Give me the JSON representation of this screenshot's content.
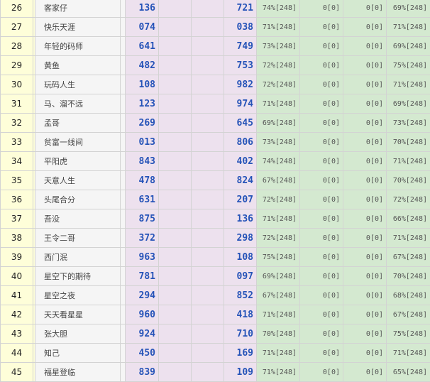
{
  "rows": [
    {
      "rank": "26",
      "name": "客家仔",
      "v1": "136",
      "v2": "721",
      "s1": "74%[248]",
      "s2": "0[0]",
      "s3": "0[0]",
      "s4": "69%[248]"
    },
    {
      "rank": "27",
      "name": "快乐天涯",
      "v1": "074",
      "v2": "038",
      "s1": "71%[248]",
      "s2": "0[0]",
      "s3": "0[0]",
      "s4": "71%[248]"
    },
    {
      "rank": "28",
      "name": "年轻的码师",
      "v1": "641",
      "v2": "749",
      "s1": "73%[248]",
      "s2": "0[0]",
      "s3": "0[0]",
      "s4": "69%[248]"
    },
    {
      "rank": "29",
      "name": "黄鱼",
      "v1": "482",
      "v2": "753",
      "s1": "72%[248]",
      "s2": "0[0]",
      "s3": "0[0]",
      "s4": "75%[248]"
    },
    {
      "rank": "30",
      "name": "玩码人生",
      "v1": "108",
      "v2": "982",
      "s1": "72%[248]",
      "s2": "0[0]",
      "s3": "0[0]",
      "s4": "71%[248]"
    },
    {
      "rank": "31",
      "name": "马、溜不远",
      "v1": "123",
      "v2": "974",
      "s1": "71%[248]",
      "s2": "0[0]",
      "s3": "0[0]",
      "s4": "69%[248]"
    },
    {
      "rank": "32",
      "name": "孟哥",
      "v1": "269",
      "v2": "645",
      "s1": "69%[248]",
      "s2": "0[0]",
      "s3": "0[0]",
      "s4": "73%[248]"
    },
    {
      "rank": "33",
      "name": "贫富一线间",
      "v1": "013",
      "v2": "806",
      "s1": "73%[248]",
      "s2": "0[0]",
      "s3": "0[0]",
      "s4": "70%[248]"
    },
    {
      "rank": "34",
      "name": "平阳虎",
      "v1": "843",
      "v2": "402",
      "s1": "74%[248]",
      "s2": "0[0]",
      "s3": "0[0]",
      "s4": "71%[248]"
    },
    {
      "rank": "35",
      "name": "天意人生",
      "v1": "478",
      "v2": "824",
      "s1": "67%[248]",
      "s2": "0[0]",
      "s3": "0[0]",
      "s4": "70%[248]"
    },
    {
      "rank": "36",
      "name": "头尾合分",
      "v1": "631",
      "v2": "207",
      "s1": "72%[248]",
      "s2": "0[0]",
      "s3": "0[0]",
      "s4": "72%[248]"
    },
    {
      "rank": "37",
      "name": "吾没",
      "v1": "875",
      "v2": "136",
      "s1": "71%[248]",
      "s2": "0[0]",
      "s3": "0[0]",
      "s4": "66%[248]"
    },
    {
      "rank": "38",
      "name": "王令二哥",
      "v1": "372",
      "v2": "298",
      "s1": "72%[248]",
      "s2": "0[0]",
      "s3": "0[0]",
      "s4": "71%[248]"
    },
    {
      "rank": "39",
      "name": "西门泯",
      "v1": "963",
      "v2": "108",
      "s1": "75%[248]",
      "s2": "0[0]",
      "s3": "0[0]",
      "s4": "67%[248]"
    },
    {
      "rank": "40",
      "name": "星空下的期待",
      "v1": "781",
      "v2": "097",
      "s1": "69%[248]",
      "s2": "0[0]",
      "s3": "0[0]",
      "s4": "70%[248]"
    },
    {
      "rank": "41",
      "name": "星空之夜",
      "v1": "294",
      "v2": "852",
      "s1": "67%[248]",
      "s2": "0[0]",
      "s3": "0[0]",
      "s4": "68%[248]"
    },
    {
      "rank": "42",
      "name": "天天看星星",
      "v1": "960",
      "v2": "418",
      "s1": "71%[248]",
      "s2": "0[0]",
      "s3": "0[0]",
      "s4": "67%[248]"
    },
    {
      "rank": "43",
      "name": "张大胆",
      "v1": "924",
      "v2": "710",
      "s1": "70%[248]",
      "s2": "0[0]",
      "s3": "0[0]",
      "s4": "75%[248]"
    },
    {
      "rank": "44",
      "name": "知己",
      "v1": "450",
      "v2": "169",
      "s1": "71%[248]",
      "s2": "0[0]",
      "s3": "0[0]",
      "s4": "71%[248]"
    },
    {
      "rank": "45",
      "name": "福星登临",
      "v1": "839",
      "v2": "109",
      "s1": "71%[248]",
      "s2": "0[0]",
      "s3": "0[0]",
      "s4": "65%[248]"
    }
  ]
}
